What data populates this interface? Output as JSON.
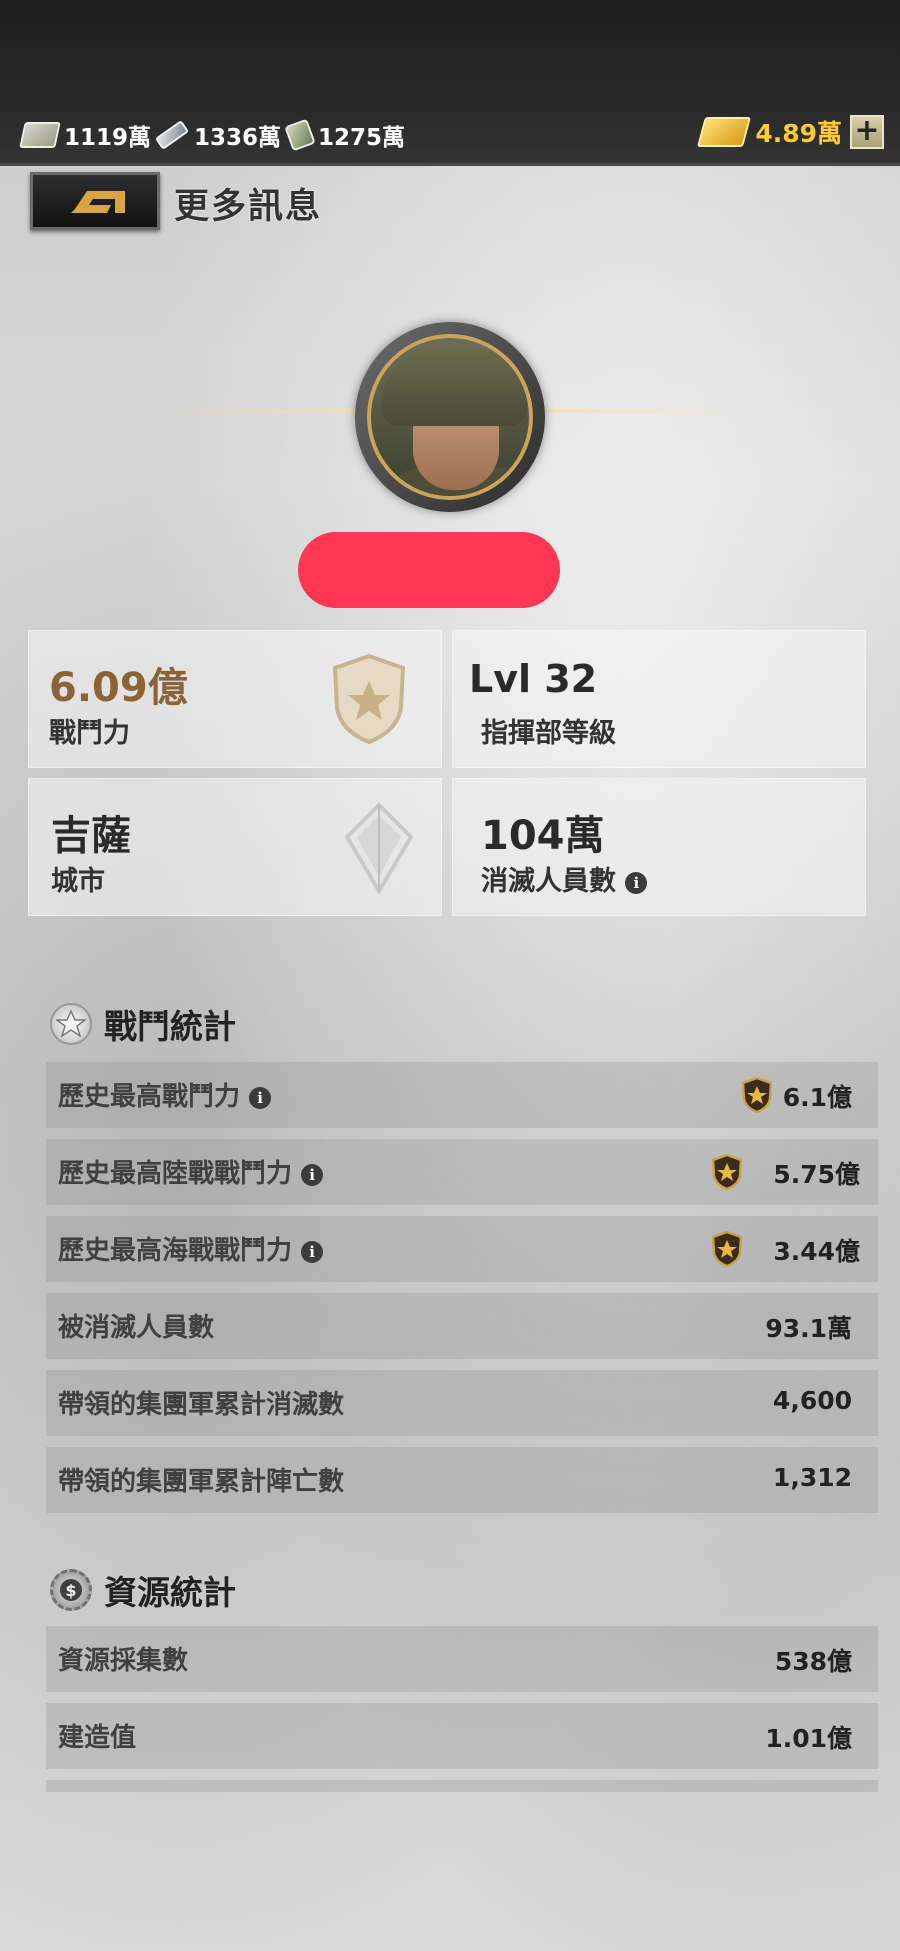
{
  "resources": {
    "cash": "1119萬",
    "steel": "1336萬",
    "oil": "1275萬",
    "gold": "4.89萬",
    "add": "+"
  },
  "header": {
    "title": "更多訊息"
  },
  "summary": {
    "power": {
      "value": "6.09億",
      "label": "戰鬥力"
    },
    "hq_level": {
      "value": "Lvl 32",
      "label": "指揮部等級"
    },
    "city": {
      "value": "吉薩",
      "label": "城市"
    },
    "kills": {
      "value": "104萬",
      "label": "消滅人員數"
    }
  },
  "battle_stats": {
    "title": "戰鬥統計",
    "rows": [
      {
        "label": "歷史最高戰鬥力",
        "value": "6.1億"
      },
      {
        "label": "歷史最高陸戰戰鬥力",
        "value": "5.75億"
      },
      {
        "label": "歷史最高海戰戰鬥力",
        "value": "3.44億"
      },
      {
        "label": "被消滅人員數",
        "value": "93.1萬"
      },
      {
        "label": "帶領的集團軍累計消滅數",
        "value": "4,600"
      },
      {
        "label": "帶領的集團軍累計陣亡數",
        "value": "1,312"
      }
    ]
  },
  "resource_stats": {
    "title": "資源統計",
    "rows": [
      {
        "label": "資源採集數",
        "value": "538億"
      },
      {
        "label": "建造值",
        "value": "1.01億"
      }
    ]
  },
  "info_glyph": "i",
  "colors": {
    "power": "#8a6336",
    "gold_text": "#ffcb2e",
    "redaction": "#ff3654"
  }
}
